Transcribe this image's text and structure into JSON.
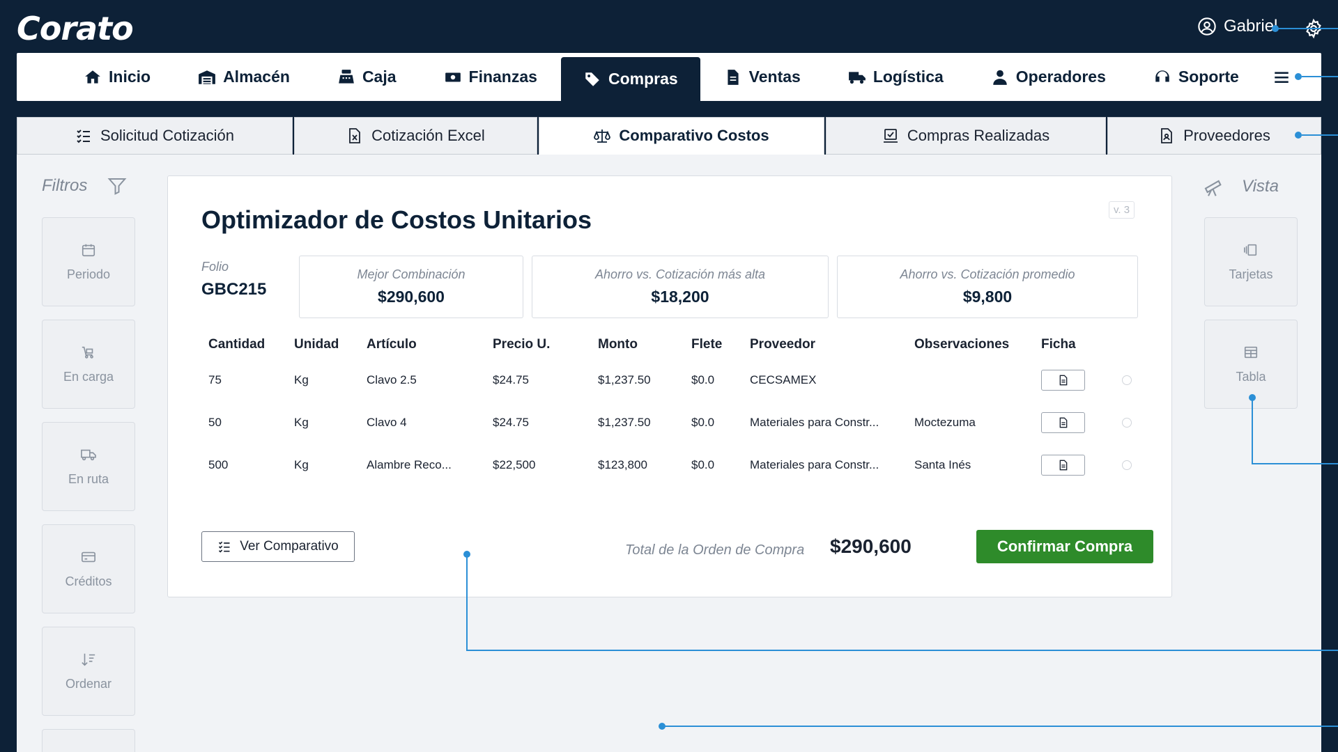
{
  "app": {
    "logo": "Corato",
    "user_name": "Gabriel"
  },
  "main_nav": [
    {
      "label": "Inicio",
      "icon": "home-icon"
    },
    {
      "label": "Almacén",
      "icon": "warehouse-icon"
    },
    {
      "label": "Caja",
      "icon": "cash-register-icon"
    },
    {
      "label": "Finanzas",
      "icon": "money-icon"
    },
    {
      "label": "Compras",
      "icon": "tags-icon",
      "active": true
    },
    {
      "label": "Ventas",
      "icon": "document-icon"
    },
    {
      "label": "Logística",
      "icon": "truck-icon"
    },
    {
      "label": "Operadores",
      "icon": "user-icon"
    },
    {
      "label": "Soporte",
      "icon": "headset-icon"
    }
  ],
  "sub_tabs": [
    {
      "label": "Solicitud Cotización",
      "icon": "checklist-icon"
    },
    {
      "label": "Cotización Excel",
      "icon": "excel-file-icon"
    },
    {
      "label": "Comparativo Costos",
      "icon": "scale-icon",
      "active": true
    },
    {
      "label": "Compras Realizadas",
      "icon": "receipt-icon"
    },
    {
      "label": "Proveedores",
      "icon": "contact-file-icon"
    }
  ],
  "filters": {
    "title": "Filtros",
    "items": [
      {
        "label": "Periodo",
        "icon": "calendar-icon"
      },
      {
        "label": "En carga",
        "icon": "loading-cart-icon"
      },
      {
        "label": "En ruta",
        "icon": "truck-route-icon"
      },
      {
        "label": "Créditos",
        "icon": "credit-card-icon"
      },
      {
        "label": "Ordenar",
        "icon": "sort-icon"
      }
    ]
  },
  "view": {
    "title": "Vista",
    "items": [
      {
        "label": "Tarjetas",
        "icon": "cards-icon"
      },
      {
        "label": "Tabla",
        "icon": "table-icon"
      }
    ]
  },
  "panel": {
    "title": "Optimizador de Costos Unitarios",
    "version": "v. 3",
    "folio_label": "Folio",
    "folio_value": "GBC215",
    "stats": [
      {
        "label": "Mejor Combinación",
        "value": "$290,600"
      },
      {
        "label": "Ahorro vs. Cotización más alta",
        "value": "$18,200"
      },
      {
        "label": "Ahorro vs. Cotización promedio",
        "value": "$9,800"
      }
    ],
    "columns": [
      "Cantidad",
      "Unidad",
      "Artículo",
      "Precio U.",
      "Monto",
      "Flete",
      "Proveedor",
      "Observaciones",
      "Ficha"
    ],
    "rows": [
      {
        "cantidad": "75",
        "unidad": "Kg",
        "articulo": "Clavo 2.5",
        "precio": "$24.75",
        "monto": "$1,237.50",
        "flete": "$0.0",
        "proveedor": "CECSAMEX",
        "observaciones": ""
      },
      {
        "cantidad": "50",
        "unidad": "Kg",
        "articulo": "Clavo 4",
        "precio": "$24.75",
        "monto": "$1,237.50",
        "flete": "$0.0",
        "proveedor": "Materiales para Constr...",
        "observaciones": "Moctezuma"
      },
      {
        "cantidad": "500",
        "unidad": "Kg",
        "articulo": "Alambre Reco...",
        "precio": "$22,500",
        "monto": "$123,800",
        "flete": "$0.0",
        "proveedor": "Materiales para Constr...",
        "observaciones": "Santa Inés"
      }
    ],
    "ver_comparativo_label": "Ver Comparativo",
    "total_label": "Total de la Orden de Compra",
    "total_value": "$290,600",
    "confirm_label": "Confirmar Compra"
  },
  "colors": {
    "navy": "#0d2137",
    "confirm_green": "#2e8b2a",
    "annotation_blue": "#2b8fd6"
  }
}
